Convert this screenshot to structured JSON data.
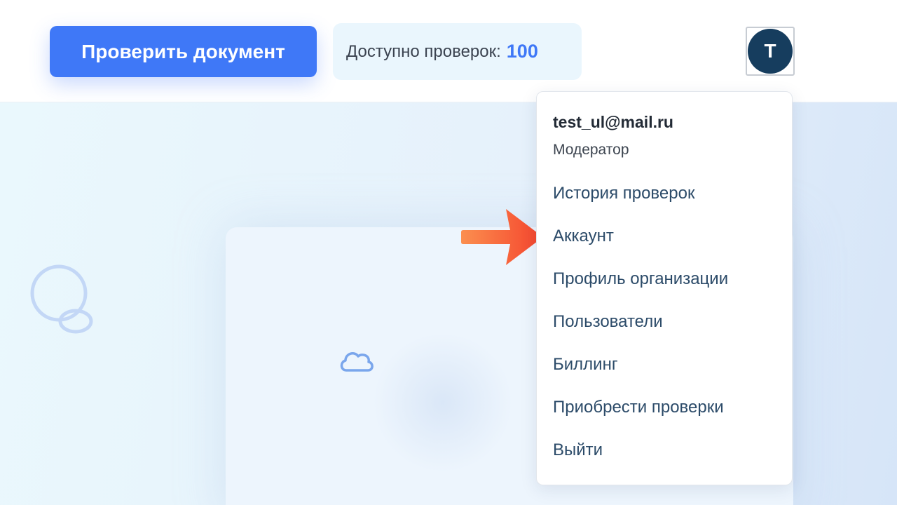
{
  "header": {
    "check_button_label": "Проверить документ",
    "credits": {
      "label": "Доступно проверок:",
      "count": "100"
    },
    "avatar_letter": "T"
  },
  "dropdown": {
    "email": "test_ul@mail.ru",
    "role": "Модератор",
    "items": [
      {
        "label": "История проверок"
      },
      {
        "label": "Аккаунт"
      },
      {
        "label": "Профиль организации"
      },
      {
        "label": "Пользователи"
      },
      {
        "label": "Биллинг"
      },
      {
        "label": "Приобрести проверки"
      },
      {
        "label": "Выйти"
      }
    ]
  },
  "icons": [
    "search-icon",
    "cloud-icon",
    "arrow-right-icon"
  ],
  "colors": {
    "accent": "#3f78f7",
    "avatar_bg": "#163d5e",
    "menu_text": "#2c4b69",
    "arrow": "#f5442d"
  }
}
